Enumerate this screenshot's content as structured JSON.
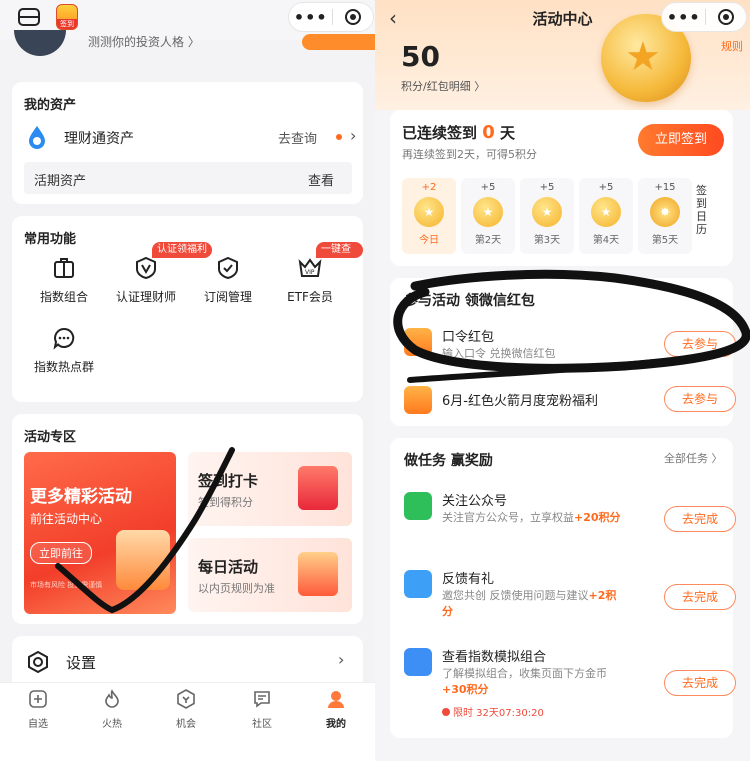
{
  "left": {
    "badge_label": "签到",
    "profile_test_text": "测测你的投资人格 〉",
    "assets": {
      "title": "我的资产",
      "account_label": "理财通资产",
      "query_label": "去查询",
      "current_label": "活期资产",
      "view_label": "查看"
    },
    "functions": {
      "title": "常用功能",
      "items": [
        {
          "label": "指数组合",
          "icon": "portfolio-icon"
        },
        {
          "label": "认证理财师",
          "icon": "verified-advisor-icon",
          "tag": "认证领福利"
        },
        {
          "label": "订阅管理",
          "icon": "subscription-icon"
        },
        {
          "label": "ETF会员",
          "icon": "vip-crown-icon",
          "tag": "一键查看"
        },
        {
          "label": "指数热点群",
          "icon": "chat-bubble-icon"
        }
      ]
    },
    "activity": {
      "title": "活动专区",
      "big_title": "更多精彩活动",
      "big_sub": "前往活动中心",
      "big_button": "立即前往",
      "big_small": "市场有风险  投资需谨慎",
      "signin_title": "签到打卡",
      "signin_sub": "签到得积分",
      "daily_title": "每日活动",
      "daily_sub": "以内页规则为准"
    },
    "settings_label": "设置",
    "tabs": [
      {
        "label": "自选",
        "icon": "plus-box-icon"
      },
      {
        "label": "火热",
        "icon": "flame-icon"
      },
      {
        "label": "机会",
        "icon": "compass-icon"
      },
      {
        "label": "社区",
        "icon": "community-icon"
      },
      {
        "label": "我的",
        "icon": "profile-icon",
        "active": true
      }
    ],
    "colors": {
      "accent": "#ff6a1e",
      "tag_red": "#f04a3a"
    }
  },
  "right": {
    "title": "活动中心",
    "rules_label": "规则",
    "points": "50",
    "points_link": "积分/红包明细 〉",
    "signin": {
      "title_prefix": "已连续签到",
      "days": "0",
      "title_suffix": "天",
      "sub": "再连续签到2天，可得5积分",
      "button": "立即签到",
      "calendar_label": "签到日历",
      "days_list": [
        {
          "plus": "+2",
          "label": "今日",
          "today": true
        },
        {
          "plus": "+5",
          "label": "第2天"
        },
        {
          "plus": "+5",
          "label": "第3天"
        },
        {
          "plus": "+5",
          "label": "第4天"
        },
        {
          "plus": "+15",
          "label": "第5天"
        }
      ]
    },
    "join": {
      "title": "参与活动 领微信红包",
      "rows": [
        {
          "title": "口令红包",
          "sub": "输入口令 兑换微信红包",
          "button": "去参与"
        },
        {
          "title": "6月-红色火箭月度宠粉福利",
          "sub": "",
          "button": "去参与"
        }
      ]
    },
    "tasks": {
      "title": "做任务 赢奖励",
      "all_label": "全部任务 〉",
      "rows": [
        {
          "title": "关注公众号",
          "sub": "关注官方公众号，立享权益",
          "reward": "+20积分",
          "button": "去完成"
        },
        {
          "title": "反馈有礼",
          "sub": "邀您共创 反馈使用问题与建议",
          "reward": "+2积分",
          "button": "去完成"
        },
        {
          "title": "查看指数模拟组合",
          "sub": "了解模拟组合，收集页面下方金币",
          "reward": "+30积分",
          "button": "去完成",
          "timer": "限时 32天07:30:20"
        }
      ]
    },
    "colors": {
      "accent": "#ff6a1e",
      "green": "#2fbf5a",
      "blue": "#3d8ff5"
    }
  }
}
